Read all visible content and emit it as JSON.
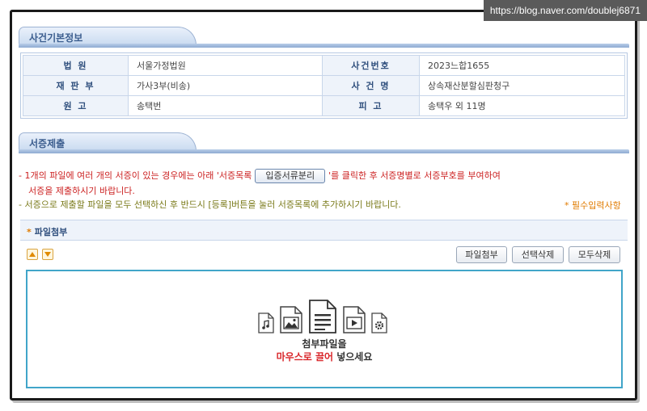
{
  "watermark": "https://blog.naver.com/doublej6871",
  "case_info": {
    "section_title": "사건기본정보",
    "rows": [
      {
        "label1": "법 원",
        "value1": "서울가정법원",
        "label2": "사건번호",
        "value2": "2023느합1655"
      },
      {
        "label1": "재 판 부",
        "value1": "가사3부(비송)",
        "label2": "사 건 명",
        "value2": "상속재산분할심판청구"
      },
      {
        "label1": "원 고",
        "value1": "송택번",
        "label2": "피 고",
        "value2": "송택우 외 11명"
      }
    ]
  },
  "evidence": {
    "section_title": "서증제출",
    "notice1_part1": "- 1개의 파일에 여러 개의 서증이 있는 경우에는 아래 '서증목록",
    "split_button": "입증서류분리",
    "notice1_part2": "'를 클릭한 후 서증명별로 서증부호를 부여하여",
    "notice1_line2": "서증을 제출하시기 바랍니다.",
    "notice2": "- 서증으로 제출할 파일을 모두 선택하신 후 반드시 [등록]버튼을 눌러 서증목록에 추가하시기 바랍니다.",
    "required_note": "* 필수입력사항",
    "attach_label": "파일첨부",
    "buttons": {
      "attach": "파일첨부",
      "delete_selected": "선택삭제",
      "delete_all": "모두삭제"
    },
    "drop_line1": "첨부파일을",
    "drop_line2_highlight": "마우스로 끌어",
    "drop_line2_rest": " 넣으세요"
  },
  "colors": {
    "accent": "#3b5d8e",
    "notice_red": "#cc2222",
    "notice_olive": "#7a7a1a",
    "required": "#e07b00",
    "dropzone_border": "#41a5c9"
  },
  "icons": [
    "music-file-icon",
    "image-file-icon",
    "document-file-icon",
    "video-file-icon",
    "settings-file-icon",
    "arrow-up-icon",
    "arrow-down-icon"
  ]
}
